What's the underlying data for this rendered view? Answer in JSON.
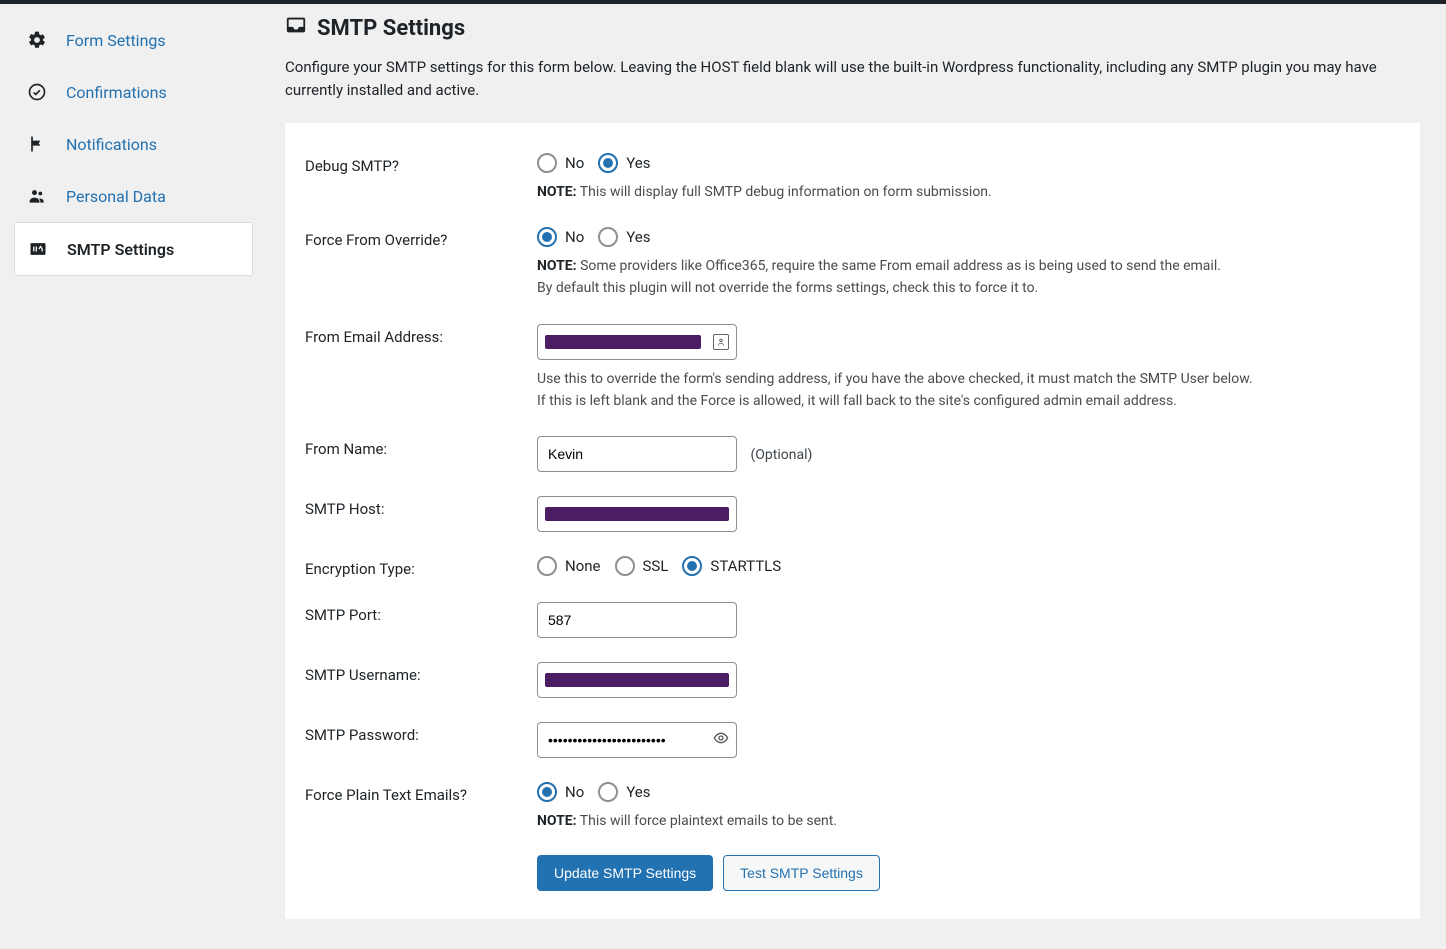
{
  "sidebar": {
    "items": [
      {
        "label": "Form Settings",
        "icon": "gear-icon",
        "active": false
      },
      {
        "label": "Confirmations",
        "icon": "check-circle-icon",
        "active": false
      },
      {
        "label": "Notifications",
        "icon": "flag-icon",
        "active": false
      },
      {
        "label": "Personal Data",
        "icon": "people-icon",
        "active": false
      },
      {
        "label": "SMTP Settings",
        "icon": "smtp-icon",
        "active": true
      }
    ]
  },
  "page": {
    "title": "SMTP Settings",
    "description": "Configure your SMTP settings for this form below. Leaving the HOST field blank will use the built-in Wordpress functionality, including any SMTP plugin you may have currently installed and active."
  },
  "labels_common": {
    "no": "No",
    "yes": "Yes",
    "note_prefix": "NOTE:"
  },
  "fields": {
    "debug": {
      "label": "Debug SMTP?",
      "value": "yes",
      "note": "This will display full SMTP debug information on form submission."
    },
    "force_from_override": {
      "label": "Force From Override?",
      "value": "no",
      "note_line1": "Some providers like Office365, require the same From email address as is being used to send the email.",
      "note_line2": "By default this plugin will not override the forms settings, check this to force it to."
    },
    "from_email": {
      "label": "From Email Address:",
      "value": "",
      "redacted": true,
      "note_line1": "Use this to override the form's sending address, if you have the above checked, it must match the SMTP User below.",
      "note_line2": "If this is left blank and the Force is allowed, it will fall back to the site's configured admin email address."
    },
    "from_name": {
      "label": "From Name:",
      "value": "Kevin",
      "optional_text": "(Optional)"
    },
    "smtp_host": {
      "label": "SMTP Host:",
      "value": "",
      "redacted": true
    },
    "encryption": {
      "label": "Encryption Type:",
      "options": {
        "none": "None",
        "ssl": "SSL",
        "starttls": "STARTTLS"
      },
      "value": "starttls"
    },
    "smtp_port": {
      "label": "SMTP Port:",
      "value": "587"
    },
    "smtp_username": {
      "label": "SMTP Username:",
      "value": "",
      "redacted": true
    },
    "smtp_password": {
      "label": "SMTP Password:",
      "value": "••••••••••••••••••••••••"
    },
    "force_plain_text": {
      "label": "Force Plain Text Emails?",
      "value": "no",
      "note": "This will force plaintext emails to be sent."
    }
  },
  "buttons": {
    "update": "Update SMTP Settings",
    "test": "Test SMTP Settings"
  }
}
